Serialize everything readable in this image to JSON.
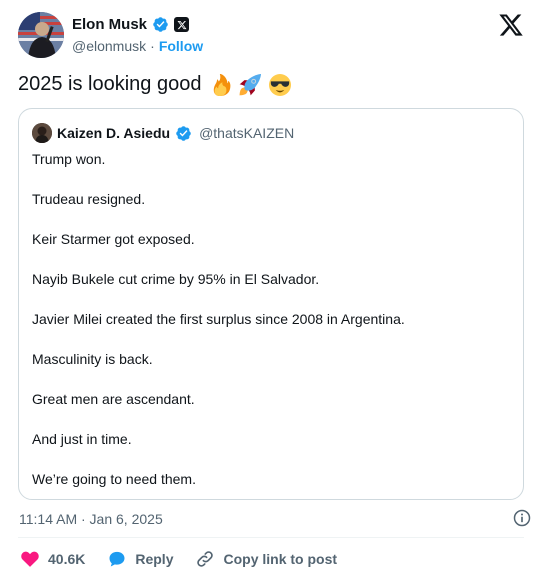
{
  "author": {
    "name": "Elon Musk",
    "handle": "@elonmusk",
    "follow_label": "Follow"
  },
  "tweet": {
    "text": "2025 is looking good",
    "emojis": [
      "fire-emoji",
      "rocket-emoji",
      "sunglasses-emoji"
    ]
  },
  "quote": {
    "name": "Kaizen D. Asiedu",
    "handle": "@thatsKAIZEN",
    "lines": [
      "Trump won.",
      "Trudeau resigned.",
      "Keir Starmer got exposed.",
      "Nayib Bukele cut crime by 95% in El Salvador.",
      "Javier Milei created the first surplus since 2008 in Argentina.",
      "Masculinity is back.",
      "Great men are ascendant.",
      "And just in time.",
      "We’re going to need them."
    ]
  },
  "meta": {
    "timestamp": "11:14 AM · Jan 6, 2025"
  },
  "actions": {
    "likes": "40.6K",
    "reply_label": "Reply",
    "copy_label": "Copy link to post"
  },
  "colors": {
    "accent": "#1d9bf0",
    "like": "#f91880",
    "text": "#0f1419",
    "muted": "#536471",
    "border": "#cfd9de"
  }
}
